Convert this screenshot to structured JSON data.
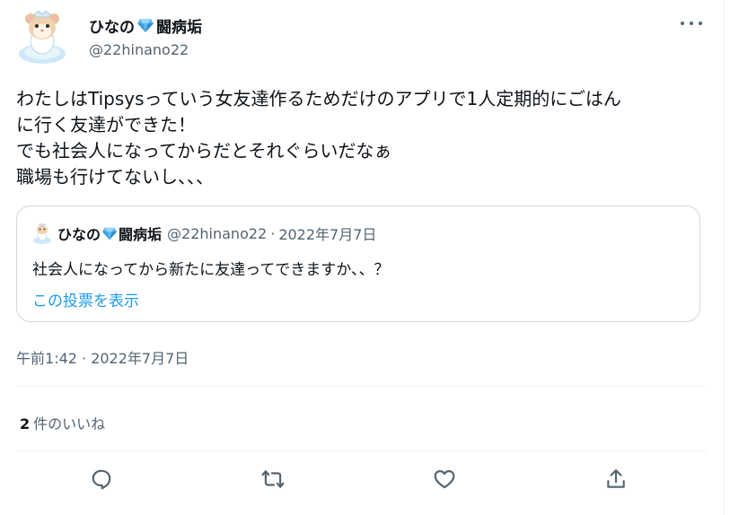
{
  "author": {
    "name_prefix": "ひなの",
    "name_suffix": "闘病垢",
    "handle": "@22hinano22"
  },
  "tweet": {
    "text": "わたしはTipsysっていう女友達作るためだけのアプリで1人定期的にごはん\nに行く友達ができた！\nでも社会人になってからだとそれぐらいだなぁ\n職場も行けてないし、、、",
    "timestamp": "午前1:42 · 2022年7月7日"
  },
  "quote": {
    "name_prefix": "ひなの",
    "name_suffix": "闘病垢",
    "handle": "@22hinano22",
    "date": "2022年7月7日",
    "separator": "·",
    "text": "社会人になってから新たに友達ってできますか、、？",
    "link": "この投票を表示"
  },
  "stats": {
    "likes_count": "2",
    "likes_label": "件のいいね"
  },
  "actions": [
    "reply-icon",
    "retweet-icon",
    "like-icon",
    "share-icon"
  ],
  "colors": {
    "text": "#0f1419",
    "secondary": "#536471",
    "accent": "#1d9bf0",
    "border": "#cfd9de"
  }
}
